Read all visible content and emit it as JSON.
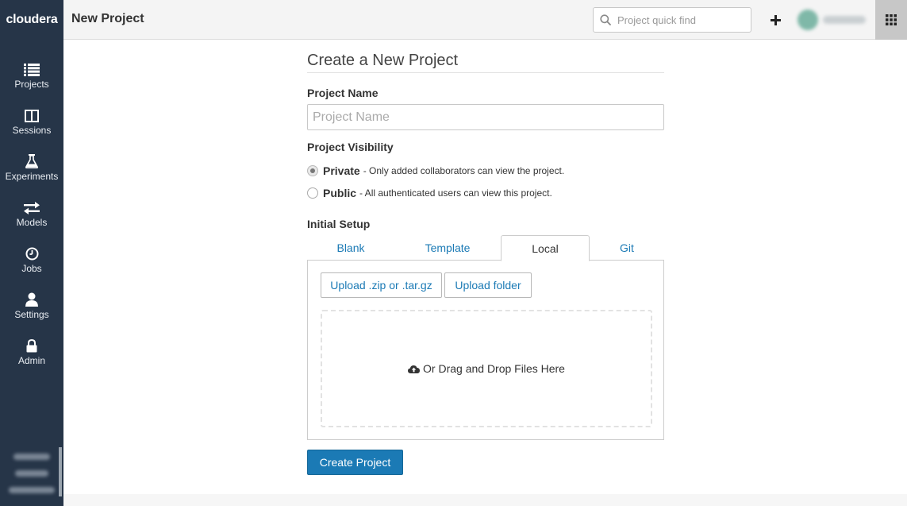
{
  "header": {
    "logo": "cloudera",
    "title": "New Project",
    "quick_find_placeholder": "Project quick find",
    "add_icon": "plus-icon",
    "apps_icon": "grid-icon"
  },
  "sidebar": {
    "items": [
      {
        "label": "Projects",
        "icon": "list-icon"
      },
      {
        "label": "Sessions",
        "icon": "columns-icon"
      },
      {
        "label": "Experiments",
        "icon": "flask-icon"
      },
      {
        "label": "Models",
        "icon": "arrows-icon"
      },
      {
        "label": "Jobs",
        "icon": "clock-icon"
      },
      {
        "label": "Settings",
        "icon": "user-icon"
      },
      {
        "label": "Admin",
        "icon": "lock-icon"
      }
    ]
  },
  "form": {
    "heading": "Create a New Project",
    "project_name_label": "Project Name",
    "project_name_placeholder": "Project Name",
    "project_name_value": "",
    "visibility_label": "Project Visibility",
    "visibility_options": [
      {
        "title": "Private",
        "desc": "- Only added collaborators can view the project.",
        "checked": true
      },
      {
        "title": "Public",
        "desc": "- All authenticated users can view this project.",
        "checked": false
      }
    ],
    "initial_setup_label": "Initial Setup",
    "tabs": [
      {
        "label": "Blank",
        "active": false
      },
      {
        "label": "Template",
        "active": false
      },
      {
        "label": "Local",
        "active": true
      },
      {
        "label": "Git",
        "active": false
      }
    ],
    "upload_zip_label": "Upload .zip or .tar.gz",
    "upload_folder_label": "Upload folder",
    "dropzone_text": "Or Drag and Drop Files Here",
    "create_button_label": "Create Project"
  },
  "colors": {
    "sidebar": "#263548",
    "accent": "#1b7ab5"
  }
}
